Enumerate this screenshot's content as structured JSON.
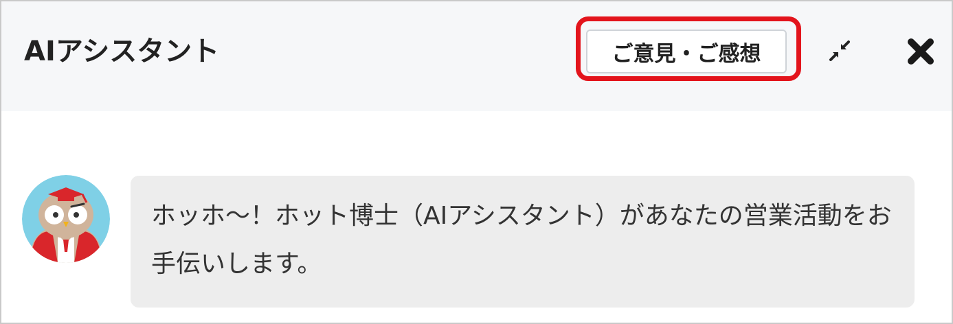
{
  "header": {
    "title": "AIアシスタント",
    "feedback_label": "ご意見・ご感想",
    "minimize_icon": "collapse-arrows-icon",
    "close_icon": "close-icon"
  },
  "chat": {
    "messages": [
      {
        "sender_avatar": "owl-professor-avatar",
        "text": "ホッホ～！ホット博士（AIアシスタント）があなたの営業活動をお手伝いします。"
      }
    ]
  },
  "colors": {
    "highlight": "#e3141c",
    "header_bg": "#f6f7f9",
    "bubble_bg": "#ededed"
  }
}
